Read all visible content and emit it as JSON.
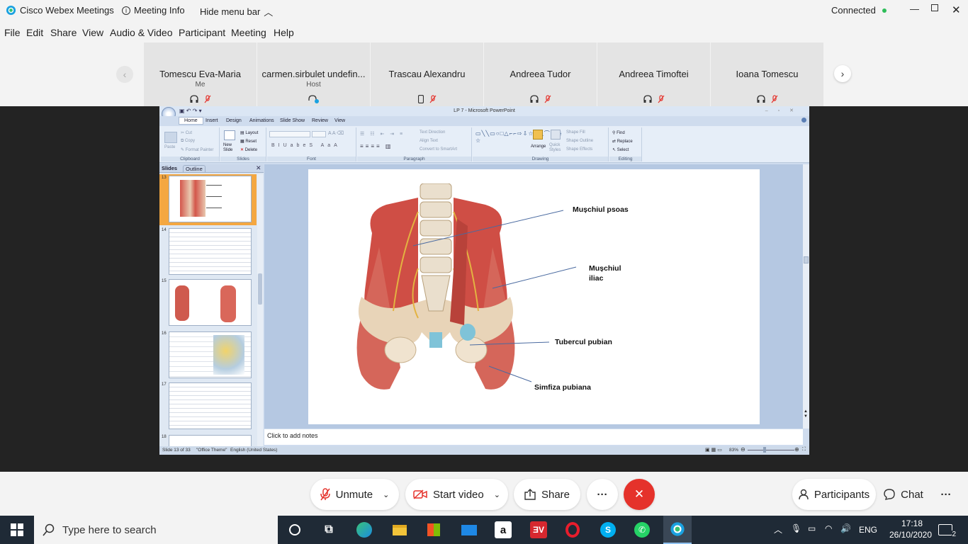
{
  "app": {
    "name": "Cisco Webex Meetings",
    "meeting_info": "Meeting Info",
    "hide_menu": "Hide menu bar",
    "status": "Connected",
    "status_color": "#2ebd59"
  },
  "menu": [
    "File",
    "Edit",
    "Share",
    "View",
    "Audio & Video",
    "Participant",
    "Meeting",
    "Help"
  ],
  "participants": [
    {
      "name": "Tomescu Eva-Maria",
      "role": "Me",
      "icons": [
        "headset-icon",
        "mic-muted-icon"
      ]
    },
    {
      "name": "carmen.sirbulet undefin...",
      "role": "Host",
      "icons": [
        "sharing-icon"
      ]
    },
    {
      "name": "Trascau Alexandru",
      "role": "",
      "icons": [
        "phone-icon",
        "mic-muted-icon"
      ]
    },
    {
      "name": "Andreea Tudor",
      "role": "",
      "icons": [
        "headset-icon",
        "mic-muted-icon"
      ]
    },
    {
      "name": "Andreea Timoftei",
      "role": "",
      "icons": [
        "headset-icon",
        "mic-muted-icon"
      ]
    },
    {
      "name": "Ioana Tomescu",
      "role": "",
      "icons": [
        "headset-icon",
        "mic-muted-icon"
      ]
    }
  ],
  "ppt": {
    "title": "LP 7 - Microsoft PowerPoint",
    "tabs": [
      "Home",
      "Insert",
      "Design",
      "Animations",
      "Slide Show",
      "Review",
      "View"
    ],
    "clipboard": {
      "paste": "Paste",
      "cut": "Cut",
      "copy": "Copy",
      "format_painter": "Format Painter",
      "label": "Clipboard"
    },
    "slides_group": {
      "new_slide": "New Slide",
      "layout": "Layout",
      "reset": "Reset",
      "delete": "Delete",
      "label": "Slides"
    },
    "font_label": "Font",
    "paragraph": {
      "text_direction": "Text Direction",
      "align_text": "Align Text",
      "smartart": "Convert to SmartArt",
      "label": "Paragraph"
    },
    "drawing": {
      "arrange": "Arrange",
      "quick_styles": "Quick Styles",
      "shape_fill": "Shape Fill",
      "shape_outline": "Shape Outline",
      "shape_effects": "Shape Effects",
      "label": "Drawing"
    },
    "editing": {
      "find": "Find",
      "replace": "Replace",
      "select": "Select",
      "label": "Editing"
    },
    "panel_tabs": {
      "slides": "Slides",
      "outline": "Outline"
    },
    "thumbs": [
      "13",
      "14",
      "15",
      "16",
      "17",
      "18"
    ],
    "slide_labels": {
      "psoas": "Mușchiul psoas",
      "iliac1": "Mușchiul",
      "iliac2": "iliac",
      "tubercul": "Tubercul pubian",
      "simfiza": "Simfiza pubiana"
    },
    "notes": "Click to add notes",
    "status": {
      "slide": "Slide 13 of 33",
      "theme": "\"Office Theme\"",
      "lang": "English (United States)",
      "zoom": "83%"
    }
  },
  "controls": {
    "unmute": "Unmute",
    "start_video": "Start video",
    "share": "Share",
    "more": "···",
    "participants": "Participants",
    "chat": "Chat",
    "end_color": "#e5322b"
  },
  "taskbar": {
    "search": "Type here to search",
    "lang": "ENG",
    "time": "17:18",
    "date": "26/10/2020",
    "notif": "2"
  }
}
